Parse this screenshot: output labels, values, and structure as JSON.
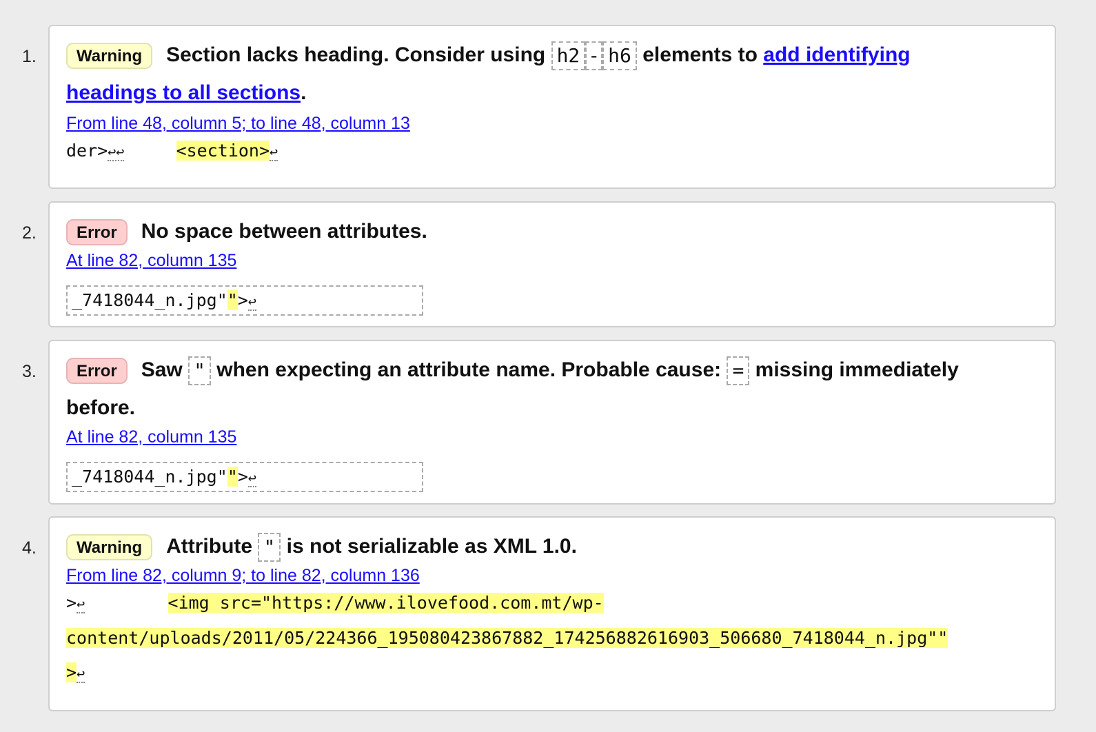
{
  "messages": [
    {
      "number": "1.",
      "type": "Warning",
      "text_before": "Section lacks heading. Consider using",
      "kw1": "h2",
      "dash": "-",
      "kw2": "h6",
      "text_mid": "elements to",
      "link": "add identifying headings to all sections",
      "link_line1": "add identifying",
      "link_line2": "headings to all sections",
      "period": ".",
      "location": "From line 48, column 5; to line 48, column 13",
      "code_pre": "der>",
      "code_ret": "↩↩",
      "code_hl": "<section>",
      "code_ret2": "↩"
    },
    {
      "number": "2.",
      "type": "Error",
      "text": "No space between attributes.",
      "location": "At line 82, column 135",
      "code_pre": "_7418044_n.jpg\"",
      "code_hl": "\"",
      "code_post": ">",
      "code_ret": "↩"
    },
    {
      "number": "3.",
      "type": "Error",
      "text_before": "Saw",
      "kw1": "\"",
      "text_mid": "when expecting an attribute name. Probable cause:",
      "kw2": "=",
      "text_after": "missing immediately",
      "text_line2": "before.",
      "location": "At line 82, column 135",
      "code_pre": "_7418044_n.jpg\"",
      "code_hl": "\"",
      "code_post": ">",
      "code_ret": "↩"
    },
    {
      "number": "4.",
      "type": "Warning",
      "text_before": "Attribute",
      "kw1": "\"",
      "text_after": "is not serializable as XML 1.0.",
      "location": "From line 82, column 9; to line 82, column 136",
      "code_pre": ">",
      "code_ret": "↩",
      "code_hl1": "<img src=\"https://www.ilovefood.com.mt/wp-",
      "code_hl2": "content/uploads/2011/05/224366_195080423867882_174256882616903_506680_7418044_n.jpg\"\"",
      "code_hl3": ">",
      "code_ret2": "↩"
    }
  ]
}
